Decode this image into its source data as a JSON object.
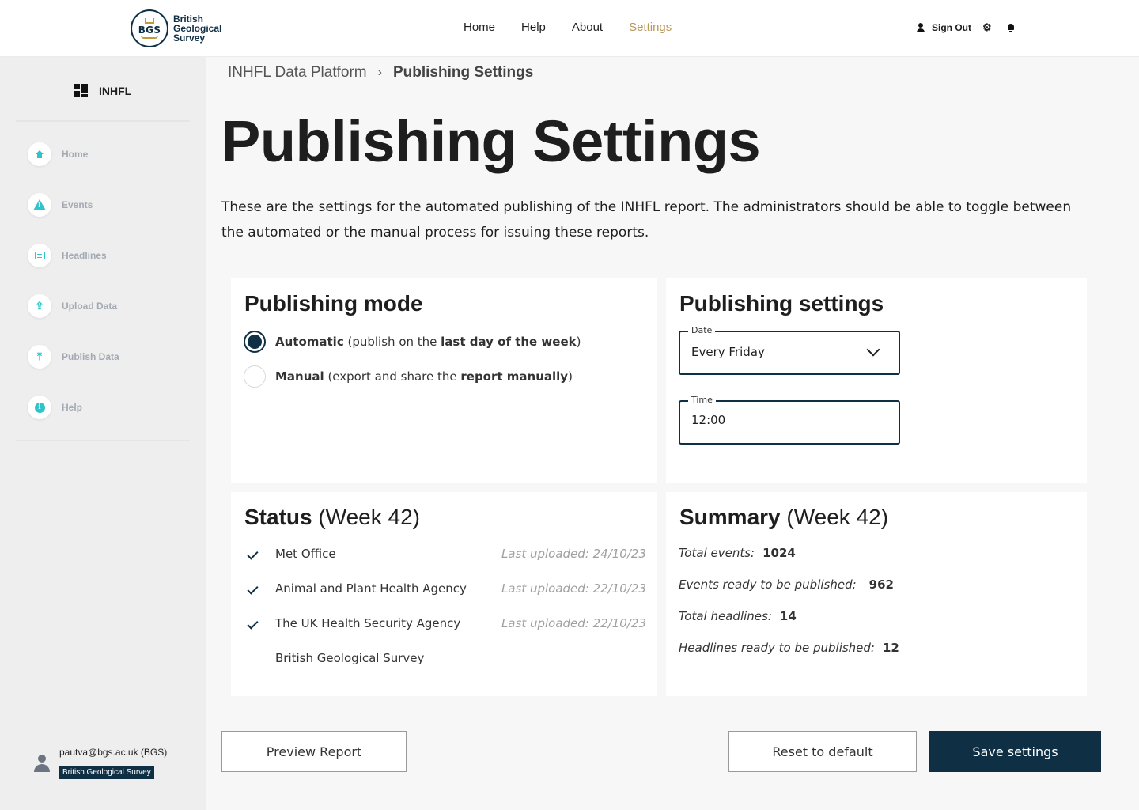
{
  "header": {
    "logo": {
      "abbr": "BGS",
      "line1": "British",
      "line2": "Geological",
      "line3": "Survey"
    },
    "nav": [
      {
        "label": "Home",
        "active": false
      },
      {
        "label": "Help",
        "active": false
      },
      {
        "label": "About",
        "active": false
      },
      {
        "label": "Settings",
        "active": true
      }
    ],
    "sign_out_label": "Sign Out",
    "icons": {
      "user": "user-icon",
      "settings": "gear-icon",
      "notifications": "bell-icon"
    }
  },
  "sidebar": {
    "brand": "INHFL",
    "items": [
      {
        "label": "Home",
        "icon": "home-icon"
      },
      {
        "label": "Events",
        "icon": "warning-icon"
      },
      {
        "label": "Headlines",
        "icon": "newspaper-icon"
      },
      {
        "label": "Upload Data",
        "icon": "upload-icon"
      },
      {
        "label": "Publish Data",
        "icon": "publish-icon"
      },
      {
        "label": "Help",
        "icon": "info-icon"
      }
    ],
    "account": {
      "email": "pautva@bgs.ac.uk (BGS)",
      "org": "British Geological Survey"
    }
  },
  "breadcrumb": {
    "root": "INHFL Data Platform",
    "separator": "›",
    "current": "Publishing Settings"
  },
  "page": {
    "title": "Publishing Settings",
    "intro": "These are the settings for the automated publishing of the INHFL report. The administrators should be able to toggle between the automated or the manual process for issuing these reports."
  },
  "publishing_mode": {
    "title": "Publishing mode",
    "options": [
      {
        "bold": "Automatic",
        "text_a": " (publish on the ",
        "bold2": "last day of the week",
        "text_b": ")",
        "checked": true
      },
      {
        "bold": "Manual",
        "text_a": " (export and share the ",
        "bold2": "report manually",
        "text_b": ")",
        "checked": false
      }
    ]
  },
  "publishing_settings": {
    "title": "Publishing settings",
    "date": {
      "label": "Date",
      "value": "Every Friday"
    },
    "time": {
      "label": "Time",
      "value": "12:00"
    }
  },
  "status": {
    "title": "Status",
    "week": "(Week 42)",
    "rows": [
      {
        "name": "Met Office",
        "date": "Last uploaded: 24/10/23",
        "done": true
      },
      {
        "name": "Animal and Plant Health Agency",
        "date": "Last uploaded: 22/10/23",
        "done": true
      },
      {
        "name": "The UK Health Security Agency",
        "date": "Last uploaded: 22/10/23",
        "done": true
      },
      {
        "name": "British Geological Survey",
        "date": "",
        "done": false
      }
    ]
  },
  "summary": {
    "title": "Summary",
    "week": "(Week 42)",
    "rows": [
      {
        "label": "Total events:",
        "value": "1024"
      },
      {
        "label": "Events ready to be published:",
        "value": "962"
      },
      {
        "label": "Total headlines:",
        "value": "14"
      },
      {
        "label": "Headlines ready to be published:",
        "value": "12"
      }
    ]
  },
  "actions": {
    "preview": "Preview Report",
    "reset": "Reset to default",
    "save": "Save settings"
  },
  "colors": {
    "primary": "#0e2f44",
    "accent_gold": "#b9975b",
    "accent_teal": "#2ec4c9"
  }
}
